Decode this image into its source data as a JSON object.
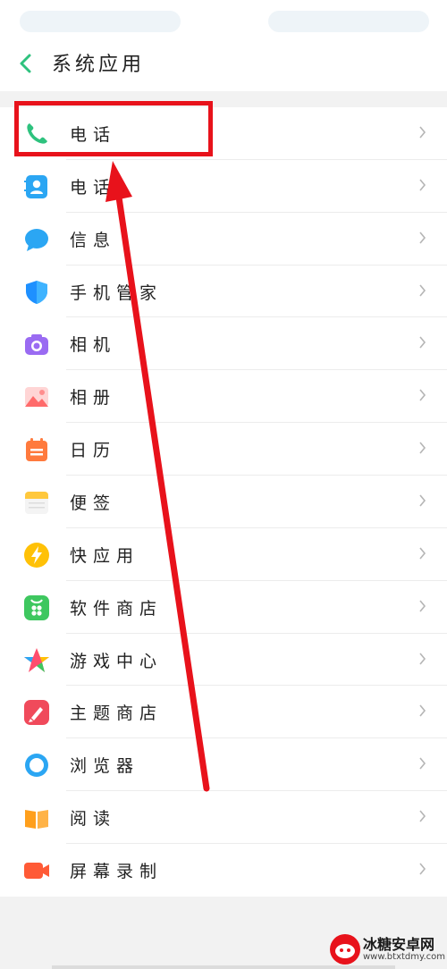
{
  "header": {
    "title": "系统应用"
  },
  "items": [
    {
      "label": "电话",
      "icon": "phone-icon",
      "color": "#2ec27e"
    },
    {
      "label": "电话",
      "icon": "contacts-icon",
      "color": "#2ba6f3"
    },
    {
      "label": "信息",
      "icon": "message-icon",
      "color": "#2ba6f3"
    },
    {
      "label": "手机管家",
      "icon": "shield-icon",
      "color": "#1e90ff"
    },
    {
      "label": "相机",
      "icon": "camera-icon",
      "color": "#9a6bf2"
    },
    {
      "label": "相册",
      "icon": "gallery-icon",
      "color": "#ff6b6b"
    },
    {
      "label": "日历",
      "icon": "calendar-icon",
      "color": "#ff7a3d"
    },
    {
      "label": "便签",
      "icon": "notes-icon",
      "color": "#ffc83d"
    },
    {
      "label": "快应用",
      "icon": "lightning-icon",
      "color": "#ffc107"
    },
    {
      "label": "软件商店",
      "icon": "app-store-icon",
      "color": "#3ec75f"
    },
    {
      "label": "游戏中心",
      "icon": "game-center-icon",
      "color": "#ff4d6d"
    },
    {
      "label": "主题商店",
      "icon": "theme-store-icon",
      "color": "#f04a5b"
    },
    {
      "label": "浏览器",
      "icon": "browser-icon",
      "color": "#2ba6f3"
    },
    {
      "label": "阅读",
      "icon": "book-icon",
      "color": "#ff9f1c"
    },
    {
      "label": "屏幕录制",
      "icon": "screen-record-icon",
      "color": "#ff5a36"
    }
  ],
  "watermark": {
    "title": "冰糖安卓网",
    "subtitle": "www.btxtdmy.com"
  },
  "annotation": {
    "color": "#e8121b"
  }
}
